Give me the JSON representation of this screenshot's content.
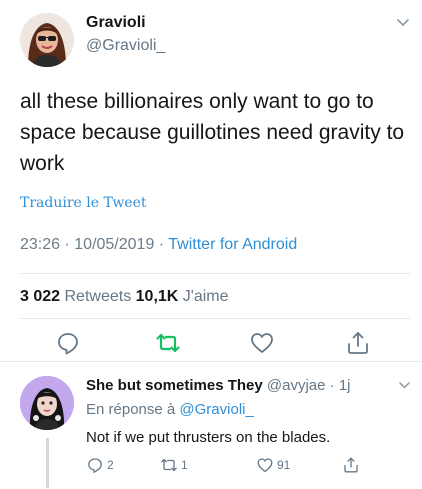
{
  "tweet": {
    "author_name": "Gravioli",
    "author_handle": "@Gravioli_",
    "text": "all these billionaires only want to go to space because guillotines need gravity to work",
    "translate_label": "Traduire le Tweet",
    "time": "23:26",
    "date": "10/05/2019",
    "separator": " · ",
    "source": "Twitter for Android",
    "retweet_count": "3 022",
    "retweet_label": " Retweets ",
    "like_count": "10,1K",
    "like_label": " J'aime",
    "icons": {
      "more": "chevron-down-icon",
      "reply": "reply-icon",
      "retweet": "retweet-icon",
      "like": "heart-icon",
      "share": "share-icon"
    }
  },
  "reply": {
    "author_name": "She but sometimes They",
    "author_handle": " @avyjae",
    "time": " · 1j",
    "in_reply_prefix": "En réponse à ",
    "in_reply_to": "@Gravioli_",
    "text": "Not if we put thrusters on the blades.",
    "reply_count": "2",
    "retweet_count": "1",
    "like_count": "91"
  },
  "colors": {
    "accent": "#2f8fd8",
    "muted": "#657786",
    "retweet_active": "#17bf63",
    "divider": "#e1e8ed"
  }
}
